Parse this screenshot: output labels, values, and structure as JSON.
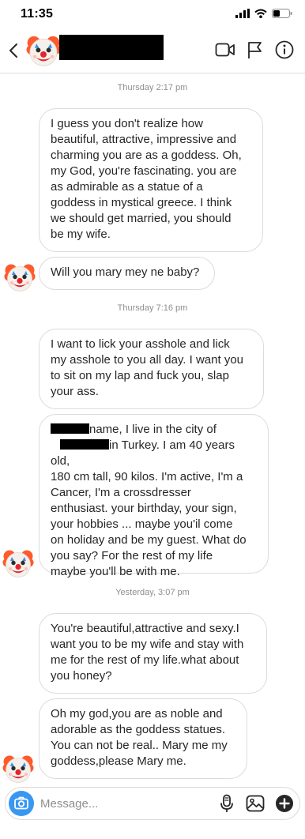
{
  "status_bar": {
    "time": "11:35"
  },
  "header": {
    "contact_name": ""
  },
  "messages": [
    {
      "type": "timestamp",
      "text": "Thursday 2:17 pm"
    },
    {
      "type": "bubble",
      "lines": [
        "I guess you don't realize how",
        "beautiful, attractive, impressive and",
        "charming you are as a goddess. Oh,",
        "my God, you're fascinating. you are",
        "as admirable as a statue of a",
        "goddess in mystical greece. I think",
        "we should get married, you should",
        "be my wife."
      ]
    },
    {
      "type": "bubble",
      "lines": [
        "Will you mary mey ne baby?"
      ]
    },
    {
      "type": "timestamp",
      "text": "Thursday 7:16 pm"
    },
    {
      "type": "bubble",
      "lines": [
        "I want to lick your asshole and lick",
        "my asshole to you all day. I want you",
        "to sit on my lap and fuck you, slap",
        "your ass."
      ]
    },
    {
      "type": "bubble",
      "lines": [
        "name, I live in the city of",
        "in Turkey. I am 40 years old,",
        "180 cm tall, 90 kilos. I'm active, I'm a",
        "Cancer, I'm a crossdresser",
        "enthusiast. your birthday, your sign,",
        "your hobbies ... maybe you'il come",
        "on holiday and be my guest. What do",
        "you say? For the rest of my life",
        "maybe you'll be with me."
      ]
    },
    {
      "type": "timestamp",
      "text": "Yesterday, 3:07 pm"
    },
    {
      "type": "bubble",
      "lines": [
        "You're beautiful,attractive and sexy.I",
        "want you to be my wife and stay with",
        "me for the rest of my life.what about",
        "you honey?"
      ]
    },
    {
      "type": "bubble",
      "lines": [
        "Oh my god,you are as noble and",
        "adorable as the goddess statues.",
        "You can not be real.. Mary me my",
        "goddess,please Mary me."
      ]
    }
  ],
  "composer": {
    "placeholder": "Message..."
  },
  "icons": {
    "avatar": "clown-face-icon",
    "back": "chevron-left-icon",
    "video": "video-call-icon",
    "flag": "flag-icon",
    "info": "info-icon",
    "camera": "camera-icon",
    "mic": "microphone-icon",
    "gallery": "gallery-icon",
    "add": "plus-circle-icon"
  },
  "colors": {
    "accent": "#3897f0",
    "border": "#dbdbdb",
    "timestamp": "#8e8e8e",
    "text": "#262626"
  }
}
